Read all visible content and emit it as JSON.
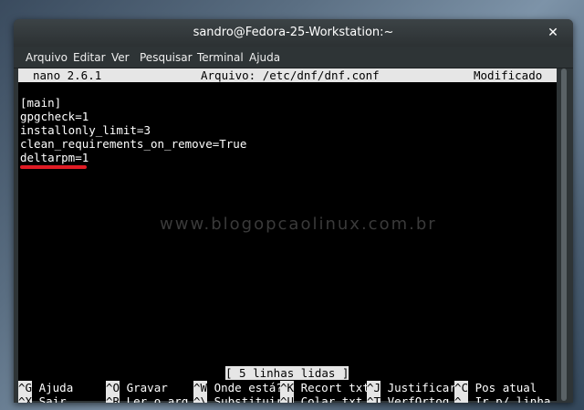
{
  "window": {
    "title": "sandro@Fedora-25-Workstation:~",
    "close_glyph": "✕"
  },
  "menubar": [
    "Arquivo",
    "Editar",
    "Ver",
    "Pesquisar",
    "Terminal",
    "Ajuda"
  ],
  "nano": {
    "version": "nano 2.6.1",
    "file": "Arquivo: /etc/dnf/dnf.conf",
    "state": "Modificado",
    "lines": [
      "[main]",
      "gpgcheck=1",
      "installonly_limit=3",
      "clean_requirements_on_remove=True",
      "deltarpm=1"
    ],
    "status": "[ 5 linhas lidas ]",
    "shortcuts_row1": [
      {
        "key": "^G",
        "label": "Ajuda"
      },
      {
        "key": "^O",
        "label": "Gravar"
      },
      {
        "key": "^W",
        "label": "Onde está?"
      },
      {
        "key": "^K",
        "label": "Recort txt"
      },
      {
        "key": "^J",
        "label": "Justificar"
      },
      {
        "key": "^C",
        "label": "Pos atual"
      }
    ],
    "shortcuts_row2": [
      {
        "key": "^X",
        "label": "Sair"
      },
      {
        "key": "^R",
        "label": "Ler o arq"
      },
      {
        "key": "^\\",
        "label": "Substituir"
      },
      {
        "key": "^U",
        "label": "Colar txt"
      },
      {
        "key": "^T",
        "label": "VerfOrtog"
      },
      {
        "key": "^_",
        "label": "Ir p/ linha"
      }
    ]
  },
  "watermark": "www.blogopcaolinux.com.br",
  "colors": {
    "highlight_underline": "#e01b24",
    "header_bg": "#e6e6e6",
    "terminal_bg": "#000000"
  }
}
